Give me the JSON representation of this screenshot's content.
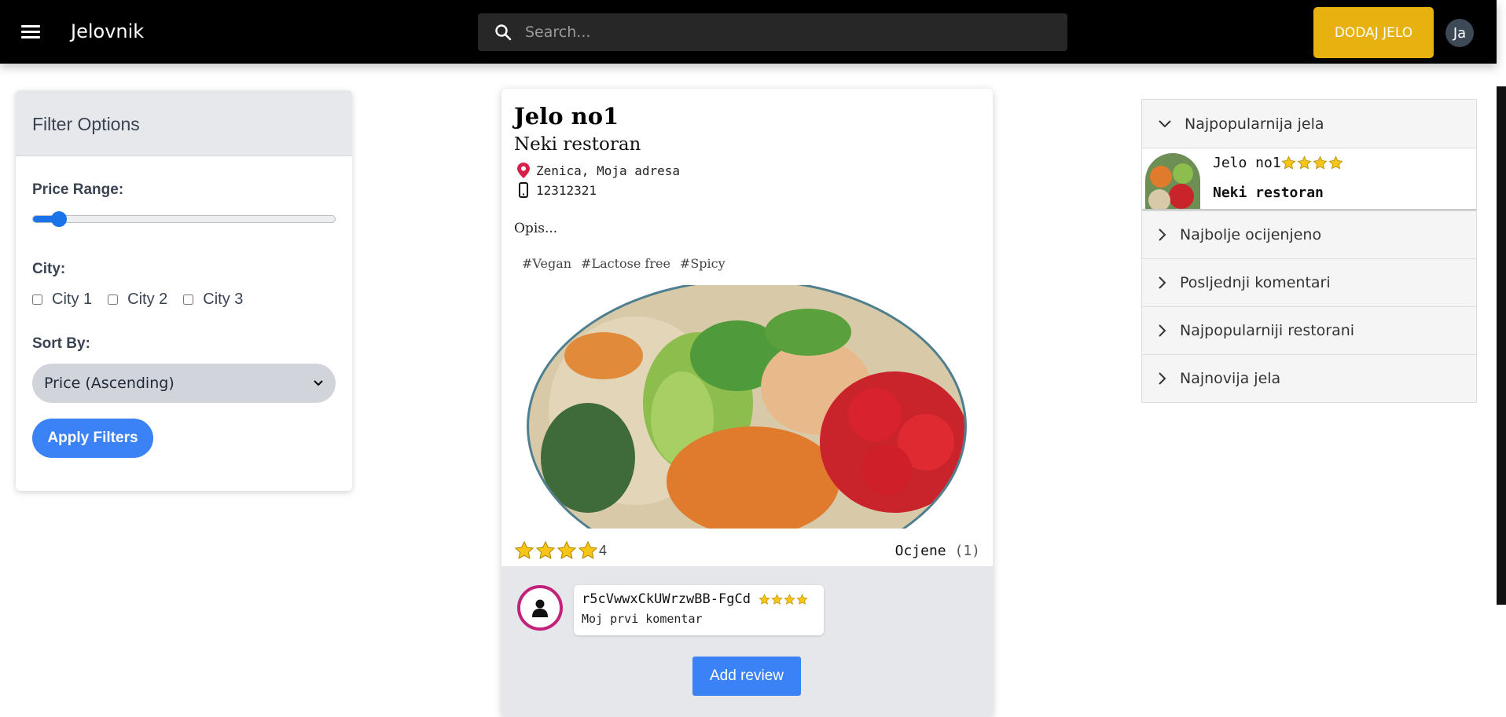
{
  "header": {
    "brand": "Jelovnik",
    "search_placeholder": "Search...",
    "add_button": "DODAJ JELO",
    "avatar_initials": "Ja"
  },
  "filters": {
    "title": "Filter Options",
    "price_label": "Price Range:",
    "price_value_fraction": 0.06,
    "city_label": "City:",
    "cities": [
      "City 1",
      "City 2",
      "City 3"
    ],
    "sort_label": "Sort By:",
    "sort_selected": "Price (Ascending)",
    "apply_label": "Apply Filters"
  },
  "dish": {
    "name": "Jelo no1",
    "restaurant": "Neki restoran",
    "address": "Zenica, Moja adresa",
    "phone": "12312321",
    "description": "Opis...",
    "tags": [
      "#Vegan",
      "#Lactose free",
      "#Spicy"
    ],
    "rating": "4",
    "stars": 4,
    "ratings_label": "Ocjene",
    "ratings_count": "(1)"
  },
  "comments": [
    {
      "user": "r5cVwwxCkUWrzwBB-FgCd",
      "stars": 4,
      "text": "Moj prvi komentar"
    }
  ],
  "add_review_label": "Add review",
  "accordion": {
    "open": {
      "title": "Najpopularnija jela",
      "item_name": "Jelo no1",
      "item_stars": 4,
      "item_restaurant": "Neki restoran"
    },
    "closed": [
      "Najbolje ocijenjeno",
      "Posljednji komentari",
      "Najpopularniji restorani",
      "Najnovija jela"
    ]
  },
  "colors": {
    "accent_yellow": "#e7b20f",
    "primary_blue": "#3b82f6",
    "star": "#f5c518",
    "pin": "#d6204a",
    "avatar_ring": "#c2227a"
  }
}
